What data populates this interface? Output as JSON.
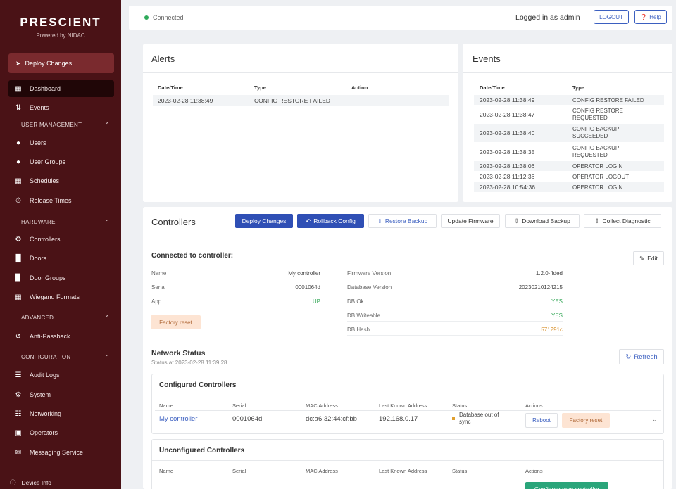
{
  "brand": {
    "title": "PRESCIENT",
    "subtitle": "Powered by NIDAC"
  },
  "sidebar": {
    "deploy": "Deploy Changes",
    "items": [
      {
        "label": "Dashboard",
        "icon": "dashboard-icon"
      },
      {
        "label": "Events",
        "icon": "events-icon"
      },
      {
        "label": "Users",
        "icon": "user-icon"
      },
      {
        "label": "User Groups",
        "icon": "user-groups-icon"
      },
      {
        "label": "Schedules",
        "icon": "calendar-icon"
      },
      {
        "label": "Release Times",
        "icon": "clock-icon"
      },
      {
        "label": "Controllers",
        "icon": "controller-icon"
      },
      {
        "label": "Doors",
        "icon": "door-icon"
      },
      {
        "label": "Door Groups",
        "icon": "door-groups-icon"
      },
      {
        "label": "Wiegand Formats",
        "icon": "wiegand-icon"
      },
      {
        "label": "Anti-Passback",
        "icon": "anti-passback-icon"
      },
      {
        "label": "Audit Logs",
        "icon": "audit-icon"
      },
      {
        "label": "System",
        "icon": "system-icon"
      },
      {
        "label": "Networking",
        "icon": "network-icon"
      },
      {
        "label": "Operators",
        "icon": "operators-icon"
      },
      {
        "label": "Messaging Service",
        "icon": "message-icon"
      }
    ],
    "sections": [
      "USER MANAGEMENT",
      "HARDWARE",
      "ADVANCED",
      "CONFIGURATION"
    ],
    "device_info": "Device Info"
  },
  "topbar": {
    "status": "Connected",
    "logged": "Logged in as admin",
    "logout": "LOGOUT",
    "help": "Help"
  },
  "alerts": {
    "title": "Alerts",
    "headers": [
      "Date/Time",
      "Type",
      "Action"
    ],
    "rows": [
      {
        "date": "2023-02-28 11:38:49",
        "type": "CONFIG RESTORE FAILED",
        "action": ""
      }
    ]
  },
  "events": {
    "title": "Events",
    "headers": [
      "Date/Time",
      "Type"
    ],
    "rows": [
      {
        "date": "2023-02-28 11:38:49",
        "type": "CONFIG RESTORE FAILED"
      },
      {
        "date": "2023-02-28 11:38:47",
        "type": "CONFIG RESTORE REQUESTED"
      },
      {
        "date": "2023-02-28 11:38:40",
        "type": "CONFIG BACKUP SUCCEEDED"
      },
      {
        "date": "2023-02-28 11:38:35",
        "type": "CONFIG BACKUP REQUESTED"
      },
      {
        "date": "2023-02-28 11:38:06",
        "type": "OPERATOR LOGIN"
      },
      {
        "date": "2023-02-28 11:12:36",
        "type": "OPERATOR LOGOUT"
      },
      {
        "date": "2023-02-28 10:54:36",
        "type": "OPERATOR LOGIN"
      }
    ]
  },
  "controllers": {
    "title": "Controllers",
    "buttons": {
      "deploy": "Deploy Changes",
      "rollback": "Rollback Config",
      "restore": "Restore Backup",
      "firmware": "Update Firmware",
      "download": "Download Backup",
      "diagnostic": "Collect Diagnostic"
    },
    "connected_label": "Connected to controller:",
    "edit": "Edit",
    "info_left": [
      {
        "key": "Name",
        "value": "My controller"
      },
      {
        "key": "Serial",
        "value": "0001064d"
      },
      {
        "key": "App",
        "value": "UP"
      }
    ],
    "info_right": [
      {
        "key": "Firmware Version",
        "value": "1.2.0-ffded"
      },
      {
        "key": "Database Version",
        "value": "20230210124215"
      },
      {
        "key": "DB Ok",
        "value": "YES"
      },
      {
        "key": "DB Writeable",
        "value": "YES"
      },
      {
        "key": "DB Hash",
        "value": "571291c"
      }
    ],
    "factory_reset": "Factory reset"
  },
  "network": {
    "title": "Network Status",
    "subtitle": "Status at 2023-02-28 11:39:28",
    "refresh": "Refresh",
    "configured": {
      "title": "Configured Controllers",
      "headers": [
        "Name",
        "Serial",
        "MAC Address",
        "Last Known Address",
        "Status",
        "Actions"
      ],
      "row": {
        "name": "My controller",
        "serial": "0001064d",
        "mac": "dc:a6:32:44:cf:bb",
        "address": "192.168.0.17",
        "status": "Database out of sync",
        "reboot": "Reboot",
        "factory": "Factory reset"
      }
    },
    "unconfigured": {
      "title": "Unconfigured Controllers",
      "headers": [
        "Name",
        "Serial",
        "MAC Address",
        "Last Known Address",
        "Status",
        "Actions"
      ],
      "configure": "Configure new controller"
    }
  }
}
